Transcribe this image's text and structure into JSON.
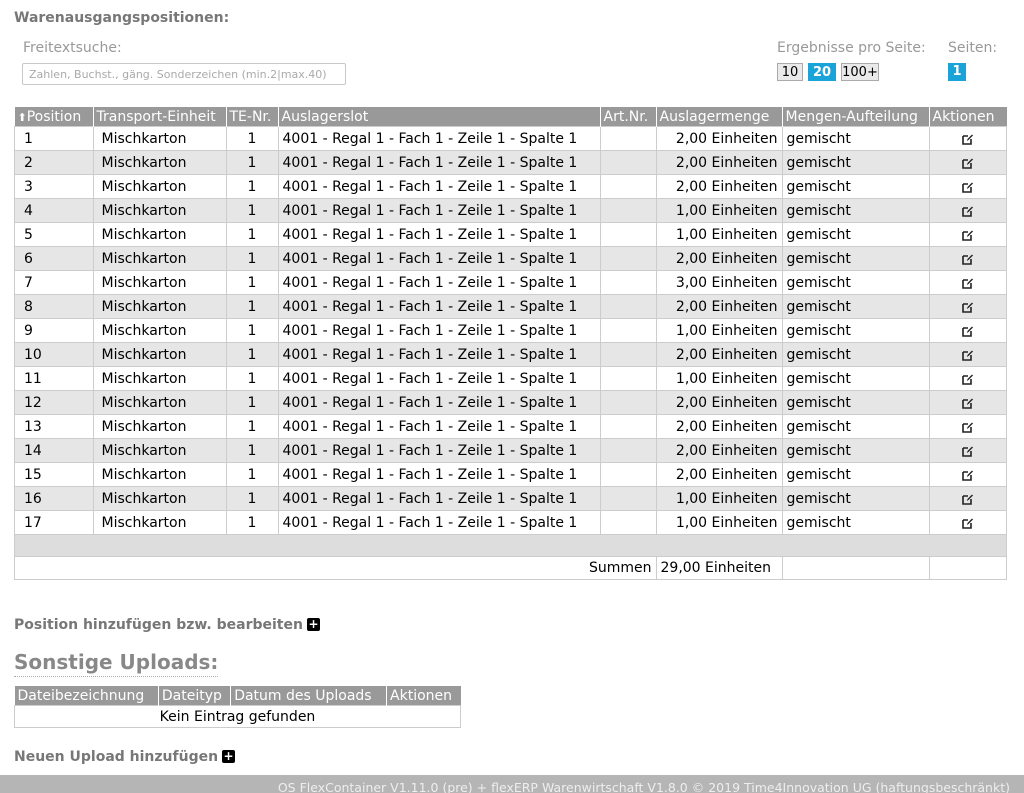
{
  "header": {
    "title": "Warenausgangspositionen:",
    "search_label": "Freitextsuche:",
    "search_placeholder": "Zahlen, Buchst., gäng. Sonderzeichen (min.2|max.40)",
    "search_value": "",
    "per_page_label": "Ergebnisse pro Seite:",
    "per_page_options": [
      "10",
      "20",
      "100+"
    ],
    "per_page_selected": "20",
    "pages_label": "Seiten:",
    "current_page": "1"
  },
  "colors": {
    "accent": "#1aa3d9",
    "header_bg": "#999999",
    "stripe": "#e6e6e6"
  },
  "table": {
    "sort_icon": "double-chevron-up-icon",
    "columns": [
      "Position",
      "Transport-Einheit",
      "TE-Nr.",
      "Auslagerslot",
      "Art.Nr.",
      "Auslagermenge",
      "Mengen-Aufteilung",
      "Aktionen"
    ],
    "rows": [
      {
        "pos": "1",
        "te": "Mischkarton",
        "te_nr": "1",
        "slot": "4001 - Regal 1 - Fach 1 - Zeile 1 - Spalte 1",
        "art": "",
        "menge": "2,00 Einheiten",
        "aufteilung": "gemischt"
      },
      {
        "pos": "2",
        "te": "Mischkarton",
        "te_nr": "1",
        "slot": "4001 - Regal 1 - Fach 1 - Zeile 1 - Spalte 1",
        "art": "",
        "menge": "2,00 Einheiten",
        "aufteilung": "gemischt"
      },
      {
        "pos": "3",
        "te": "Mischkarton",
        "te_nr": "1",
        "slot": "4001 - Regal 1 - Fach 1 - Zeile 1 - Spalte 1",
        "art": "",
        "menge": "2,00 Einheiten",
        "aufteilung": "gemischt"
      },
      {
        "pos": "4",
        "te": "Mischkarton",
        "te_nr": "1",
        "slot": "4001 - Regal 1 - Fach 1 - Zeile 1 - Spalte 1",
        "art": "",
        "menge": "1,00 Einheiten",
        "aufteilung": "gemischt"
      },
      {
        "pos": "5",
        "te": "Mischkarton",
        "te_nr": "1",
        "slot": "4001 - Regal 1 - Fach 1 - Zeile 1 - Spalte 1",
        "art": "",
        "menge": "1,00 Einheiten",
        "aufteilung": "gemischt"
      },
      {
        "pos": "6",
        "te": "Mischkarton",
        "te_nr": "1",
        "slot": "4001 - Regal 1 - Fach 1 - Zeile 1 - Spalte 1",
        "art": "",
        "menge": "2,00 Einheiten",
        "aufteilung": "gemischt"
      },
      {
        "pos": "7",
        "te": "Mischkarton",
        "te_nr": "1",
        "slot": "4001 - Regal 1 - Fach 1 - Zeile 1 - Spalte 1",
        "art": "",
        "menge": "3,00 Einheiten",
        "aufteilung": "gemischt"
      },
      {
        "pos": "8",
        "te": "Mischkarton",
        "te_nr": "1",
        "slot": "4001 - Regal 1 - Fach 1 - Zeile 1 - Spalte 1",
        "art": "",
        "menge": "2,00 Einheiten",
        "aufteilung": "gemischt"
      },
      {
        "pos": "9",
        "te": "Mischkarton",
        "te_nr": "1",
        "slot": "4001 - Regal 1 - Fach 1 - Zeile 1 - Spalte 1",
        "art": "",
        "menge": "1,00 Einheiten",
        "aufteilung": "gemischt"
      },
      {
        "pos": "10",
        "te": "Mischkarton",
        "te_nr": "1",
        "slot": "4001 - Regal 1 - Fach 1 - Zeile 1 - Spalte 1",
        "art": "",
        "menge": "2,00 Einheiten",
        "aufteilung": "gemischt"
      },
      {
        "pos": "11",
        "te": "Mischkarton",
        "te_nr": "1",
        "slot": "4001 - Regal 1 - Fach 1 - Zeile 1 - Spalte 1",
        "art": "",
        "menge": "1,00 Einheiten",
        "aufteilung": "gemischt"
      },
      {
        "pos": "12",
        "te": "Mischkarton",
        "te_nr": "1",
        "slot": "4001 - Regal 1 - Fach 1 - Zeile 1 - Spalte 1",
        "art": "",
        "menge": "2,00 Einheiten",
        "aufteilung": "gemischt"
      },
      {
        "pos": "13",
        "te": "Mischkarton",
        "te_nr": "1",
        "slot": "4001 - Regal 1 - Fach 1 - Zeile 1 - Spalte 1",
        "art": "",
        "menge": "2,00 Einheiten",
        "aufteilung": "gemischt"
      },
      {
        "pos": "14",
        "te": "Mischkarton",
        "te_nr": "1",
        "slot": "4001 - Regal 1 - Fach 1 - Zeile 1 - Spalte 1",
        "art": "",
        "menge": "2,00 Einheiten",
        "aufteilung": "gemischt"
      },
      {
        "pos": "15",
        "te": "Mischkarton",
        "te_nr": "1",
        "slot": "4001 - Regal 1 - Fach 1 - Zeile 1 - Spalte 1",
        "art": "",
        "menge": "2,00 Einheiten",
        "aufteilung": "gemischt"
      },
      {
        "pos": "16",
        "te": "Mischkarton",
        "te_nr": "1",
        "slot": "4001 - Regal 1 - Fach 1 - Zeile 1 - Spalte 1",
        "art": "",
        "menge": "1,00 Einheiten",
        "aufteilung": "gemischt"
      },
      {
        "pos": "17",
        "te": "Mischkarton",
        "te_nr": "1",
        "slot": "4001 - Regal 1 - Fach 1 - Zeile 1 - Spalte 1",
        "art": "",
        "menge": "1,00 Einheiten",
        "aufteilung": "gemischt"
      }
    ],
    "row_action_icon": "edit-icon",
    "sum_label": "Summen",
    "sum_value": "29,00 Einheiten"
  },
  "add_position_link": "Position hinzufügen bzw. bearbeiten",
  "uploads": {
    "title": "Sonstige Uploads:",
    "columns": [
      "Dateibezeichnung",
      "Dateityp",
      "Datum des Uploads",
      "Aktionen"
    ],
    "empty_text": "Kein Eintrag gefunden",
    "add_link": "Neuen Upload hinzufügen"
  },
  "footer": "OS FlexContainer V1.11.0 (pre) + flexERP Warenwirtschaft V1.8.0 © 2019 Time4Innovation UG (haftungsbeschränkt)"
}
